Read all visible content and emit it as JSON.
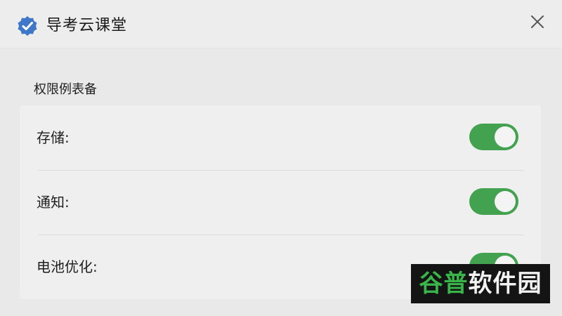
{
  "app": {
    "title": "导考云课堂",
    "icon": "shield-check-icon",
    "close_icon": "close-icon"
  },
  "permissions": {
    "section_title": "权限例表备",
    "items": [
      {
        "label": "存储:",
        "enabled": true
      },
      {
        "label": "通知:",
        "enabled": true
      },
      {
        "label": "电池优化:",
        "enabled": true
      }
    ]
  },
  "watermark": {
    "part1": "谷普",
    "part2": "软件园"
  },
  "colors": {
    "toggle_on": "#43a24f",
    "app_icon": "#3f78c8",
    "watermark_green": "#39b54a"
  }
}
